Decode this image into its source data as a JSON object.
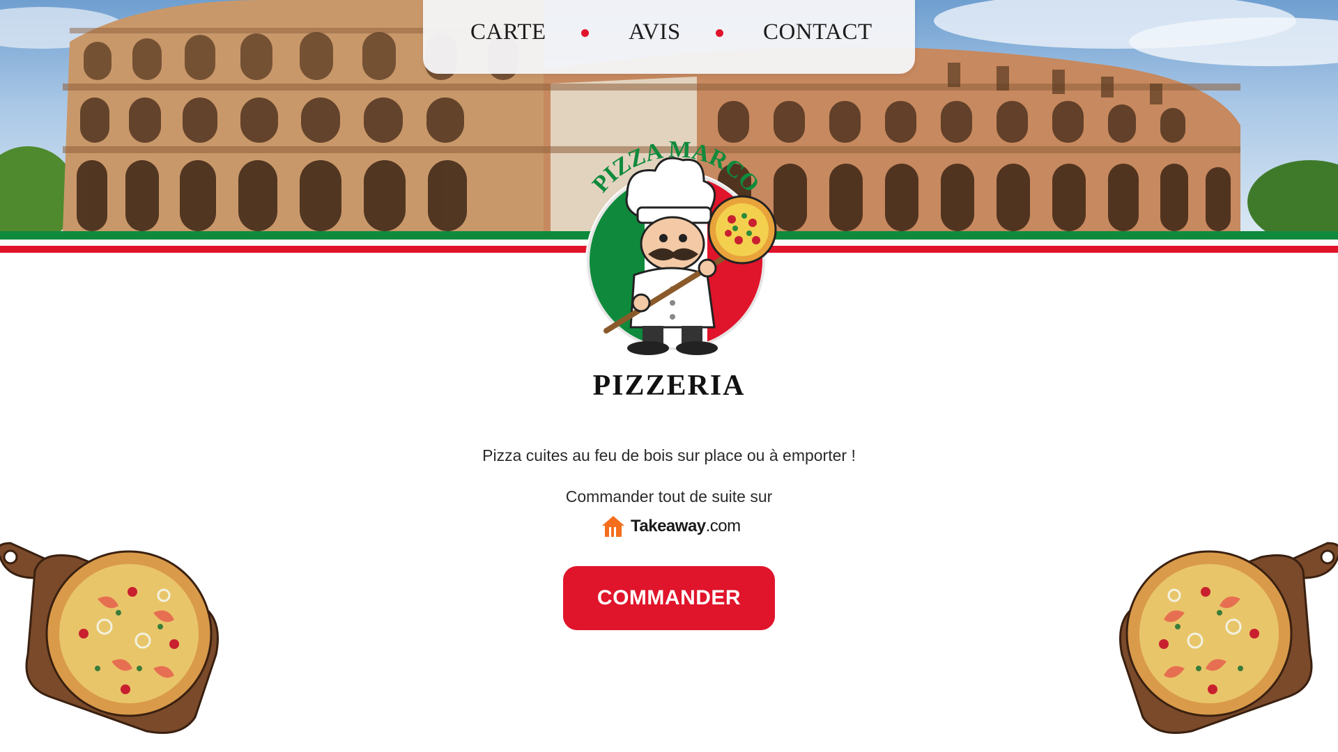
{
  "nav": {
    "items": [
      {
        "label": "CARTE"
      },
      {
        "label": "AVIS"
      },
      {
        "label": "CONTACT"
      }
    ],
    "separator_color": "#e0142b"
  },
  "hero": {
    "image": "colosseum-photo"
  },
  "logo": {
    "arc_text": "PIZZA MARCO",
    "title": "PIZZERIA"
  },
  "main": {
    "tagline": "Pizza cuites au feu de bois sur place ou à emporter !",
    "order_prompt": "Commander tout de suite sur",
    "takeaway_brand": "Takeaway",
    "takeaway_suffix": ".com",
    "order_button": "COMMANDER"
  },
  "colors": {
    "accent_red": "#e0142b",
    "flag_green": "#0f8a3c",
    "takeaway_orange": "#f36e1d"
  }
}
